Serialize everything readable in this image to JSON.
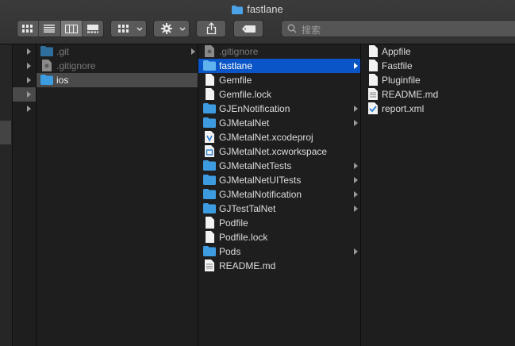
{
  "window": {
    "title": "fastlane"
  },
  "toolbar": {
    "view_modes": [
      "icon-view",
      "list-view",
      "column-view",
      "gallery-view"
    ],
    "selected_view": "column-view",
    "search_placeholder": "搜索"
  },
  "column0": {
    "rows": [
      "",
      "",
      "",
      "",
      ""
    ]
  },
  "column1": {
    "items": [
      {
        "name": ".git",
        "icon": "folder-icon",
        "dim": true
      },
      {
        "name": ".gitignore",
        "icon": "text-doc-icon",
        "dim": true
      },
      {
        "name": "ios",
        "icon": "folder-icon",
        "dim": false
      }
    ]
  },
  "column2": {
    "items": [
      {
        "name": ".gitignore",
        "icon": "text-doc-icon",
        "dim": true
      },
      {
        "name": "fastlane",
        "icon": "folder-icon",
        "arrow": true
      },
      {
        "name": "Gemfile",
        "icon": "file-icon"
      },
      {
        "name": "Gemfile.lock",
        "icon": "file-icon"
      },
      {
        "name": "GJEnNotification",
        "icon": "folder-icon",
        "arrow": true
      },
      {
        "name": "GJMetalNet",
        "icon": "folder-icon",
        "arrow": true
      },
      {
        "name": "GJMetalNet.xcodeproj",
        "icon": "xcodeproj-icon"
      },
      {
        "name": "GJMetalNet.xcworkspace",
        "icon": "xcworkspace-icon"
      },
      {
        "name": "GJMetalNetTests",
        "icon": "folder-icon",
        "arrow": true
      },
      {
        "name": "GJMetalNetUITests",
        "icon": "folder-icon",
        "arrow": true
      },
      {
        "name": "GJMetalNotification",
        "icon": "folder-icon",
        "arrow": true
      },
      {
        "name": "GJTestTalNet",
        "icon": "folder-icon",
        "arrow": true
      },
      {
        "name": "Podfile",
        "icon": "file-icon"
      },
      {
        "name": "Podfile.lock",
        "icon": "file-icon"
      },
      {
        "name": "Pods",
        "icon": "folder-icon",
        "arrow": true
      },
      {
        "name": "README.md",
        "icon": "text-doc-icon"
      }
    ]
  },
  "column3": {
    "items": [
      {
        "name": "Appfile",
        "icon": "file-icon"
      },
      {
        "name": "Fastfile",
        "icon": "file-icon"
      },
      {
        "name": "Pluginfile",
        "icon": "file-icon"
      },
      {
        "name": "README.md",
        "icon": "text-doc-icon"
      },
      {
        "name": "report.xml",
        "icon": "xml-icon"
      }
    ]
  },
  "colors": {
    "selection": "#0a56c8",
    "folder": "#3d9be0"
  }
}
